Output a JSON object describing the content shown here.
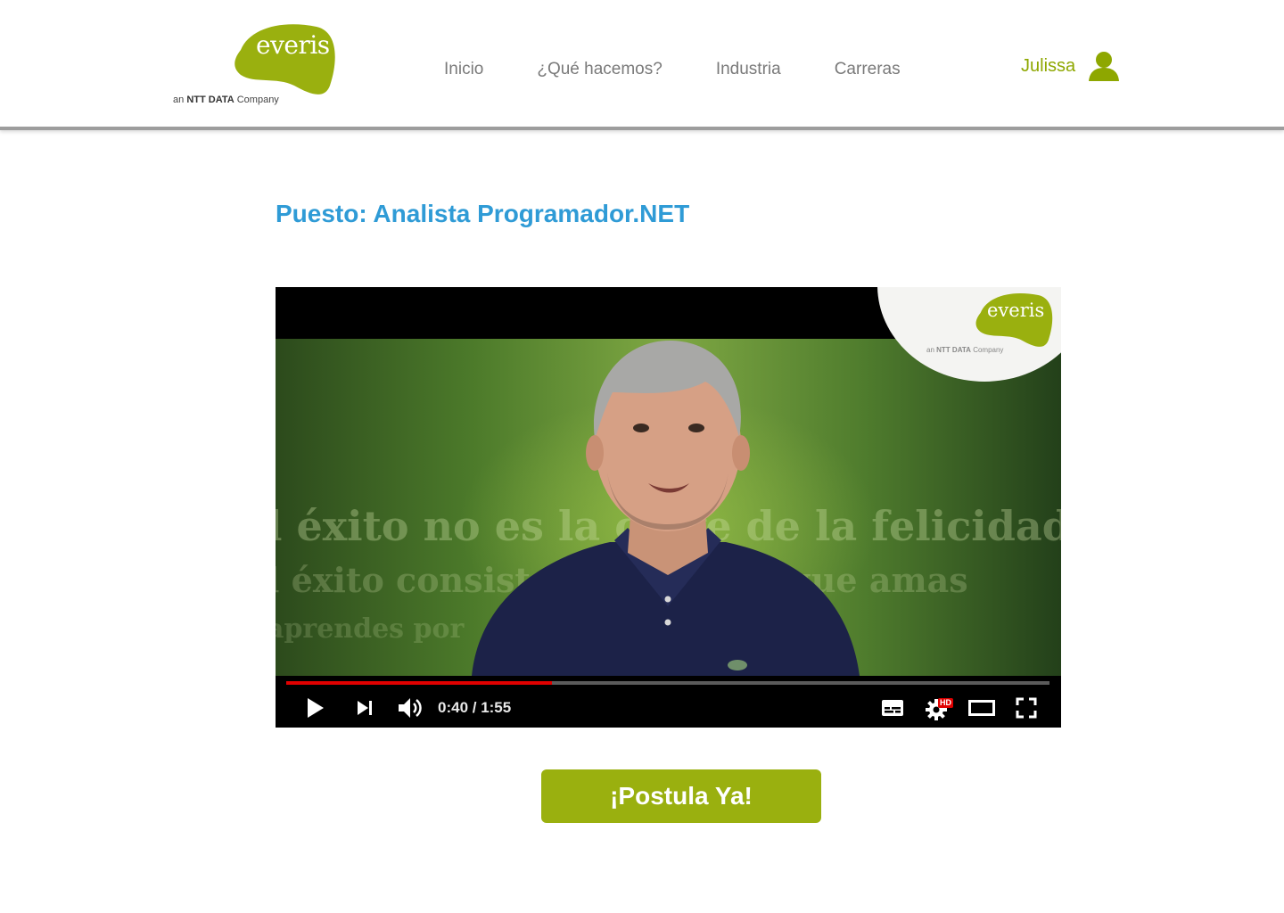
{
  "header": {
    "logo": {
      "wordmark": "everis",
      "tagline_prefix": "an",
      "tagline_brand": "NTT DATA",
      "tagline_suffix": "Company"
    },
    "nav": [
      {
        "label": "Inicio"
      },
      {
        "label": "¿Qué hacemos?"
      },
      {
        "label": "Industria"
      },
      {
        "label": "Carreras"
      }
    ],
    "user": {
      "name": "Julissa",
      "icon": "user-icon"
    }
  },
  "main": {
    "title": "Puesto: Analista Programador.NET",
    "video": {
      "overlay_text": [
        "l éxito no es la clave de la felicidad. La",
        "l éxito consiste en hacer lo que amas",
        "aprendes por"
      ],
      "corner_logo": {
        "wordmark": "everis",
        "tagline_prefix": "an",
        "tagline_brand": "NTT DATA",
        "tagline_suffix": "Company"
      },
      "progress": 0.3478,
      "current_time": "0:40",
      "duration": "1:55",
      "time_display": "0:40 / 1:55",
      "hd_badge": "HD",
      "icons": [
        "play-icon",
        "next-icon",
        "volume-icon",
        "subtitles-icon",
        "settings-icon",
        "theater-mode-icon",
        "fullscreen-icon"
      ]
    },
    "cta_label": "¡Postula Ya!"
  },
  "colors": {
    "brand_green": "#9ab00f",
    "title_blue": "#2f9bd6",
    "nav_gray": "#7a7a7a",
    "progress_red": "#e00000"
  }
}
